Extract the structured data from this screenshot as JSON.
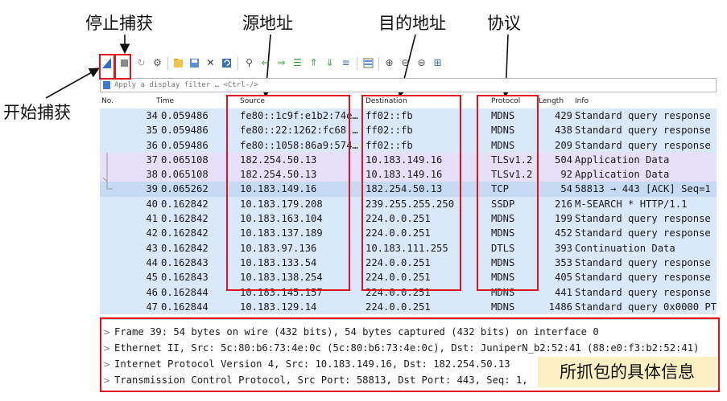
{
  "annotations": {
    "stop_capture": "停止捕获",
    "source_address": "源地址",
    "destination_address": "目的地址",
    "protocol": "协议",
    "start_capture": "开始捕获",
    "packet_details": "所抓包的具体信息"
  },
  "filter": {
    "placeholder": "Apply a display filter … <Ctrl-/>"
  },
  "columns": {
    "no": "No.",
    "time": "Time",
    "source": "Source",
    "destination": "Destination",
    "protocol": "Protocol",
    "length": "Length",
    "info": "Info"
  },
  "packets": [
    {
      "no": "34",
      "time": "0.059486",
      "src": "fe80::1c9f:e1b2:74e…",
      "dst": "ff02::fb",
      "proto": "MDNS",
      "len": "429",
      "info": "Standard query response",
      "color": "#dae8fb"
    },
    {
      "no": "35",
      "time": "0.059486",
      "src": "fe80::22:1262:fc68:…",
      "dst": "ff02::fb",
      "proto": "MDNS",
      "len": "438",
      "info": "Standard query response",
      "color": "#dae8fb"
    },
    {
      "no": "36",
      "time": "0.059486",
      "src": "fe80::1058:86a9:574…",
      "dst": "ff02::fb",
      "proto": "MDNS",
      "len": "209",
      "info": "Standard query response",
      "color": "#dae8fb"
    },
    {
      "no": "37",
      "time": "0.065108",
      "src": "182.254.50.13",
      "dst": "10.183.149.16",
      "proto": "TLSv1.2",
      "len": "504",
      "info": "Application Data",
      "color": "#e6e0fa"
    },
    {
      "no": "38",
      "time": "0.065108",
      "src": "182.254.50.13",
      "dst": "10.183.149.16",
      "proto": "TLSv1.2",
      "len": "92",
      "info": "Application Data",
      "color": "#e6e0fa"
    },
    {
      "no": "39",
      "time": "0.065262",
      "src": "10.183.149.16",
      "dst": "182.254.50.13",
      "proto": "TCP",
      "len": "54",
      "info": "58813 → 443 [ACK] Seq=1",
      "color": "#c6daf4"
    },
    {
      "no": "40",
      "time": "0.162842",
      "src": "10.183.179.208",
      "dst": "239.255.255.250",
      "proto": "SSDP",
      "len": "216",
      "info": "M-SEARCH * HTTP/1.1",
      "color": "#dae8fb"
    },
    {
      "no": "41",
      "time": "0.162842",
      "src": "10.183.163.104",
      "dst": "224.0.0.251",
      "proto": "MDNS",
      "len": "199",
      "info": "Standard query response",
      "color": "#dae8fb"
    },
    {
      "no": "42",
      "time": "0.162842",
      "src": "10.183.137.189",
      "dst": "224.0.0.251",
      "proto": "MDNS",
      "len": "452",
      "info": "Standard query response",
      "color": "#dae8fb"
    },
    {
      "no": "43",
      "time": "0.162842",
      "src": "10.183.97.136",
      "dst": "10.183.111.255",
      "proto": "DTLS",
      "len": "393",
      "info": "Continuation Data",
      "color": "#dae8fb"
    },
    {
      "no": "44",
      "time": "0.162843",
      "src": "10.183.133.54",
      "dst": "224.0.0.251",
      "proto": "MDNS",
      "len": "353",
      "info": "Standard query response",
      "color": "#dae8fb"
    },
    {
      "no": "45",
      "time": "0.162843",
      "src": "10.183.138.254",
      "dst": "224.0.0.251",
      "proto": "MDNS",
      "len": "405",
      "info": "Standard query response",
      "color": "#dae8fb"
    },
    {
      "no": "46",
      "time": "0.162844",
      "src": "10.183.145.157",
      "dst": "224.0.0.251",
      "proto": "MDNS",
      "len": "441",
      "info": "Standard query response",
      "color": "#dae8fb"
    },
    {
      "no": "47",
      "time": "0.162844",
      "src": "10.183.129.14",
      "dst": "224.0.0.251",
      "proto": "MDNS",
      "len": "1486",
      "info": "Standard query 0x0000 PT",
      "color": "#dae8fb"
    }
  ],
  "details": [
    "Frame 39: 54 bytes on wire (432 bits), 54 bytes captured (432 bits) on interface 0",
    "Ethernet II, Src: 5c:80:b6:73:4e:0c (5c:80:b6:73:4e:0c), Dst: JuniperN_b2:52:41 (88:e0:f3:b2:52:41)",
    "Internet Protocol Version 4, Src: 10.183.149.16, Dst: 182.254.50.13",
    "Transmission Control Protocol, Src Port: 58813, Dst Port: 443, Seq: 1,"
  ],
  "colors": {
    "annotation_red": "#e0141c",
    "label_highlight": "#fdf1c4",
    "row_default": "#dae8fb",
    "row_tls": "#e6e0fa",
    "row_selected": "#c6daf4"
  },
  "icons": [
    "start-capture-icon",
    "stop-capture-icon",
    "restart-capture-icon",
    "options-icon",
    "open-file-icon",
    "save-file-icon",
    "close-file-icon",
    "reload-file-icon",
    "find-icon",
    "go-back-icon",
    "go-forward-icon",
    "go-to-packet-icon",
    "go-first-icon",
    "go-last-icon",
    "autoscroll-icon",
    "colorize-icon",
    "zoom-in-icon",
    "zoom-out-icon",
    "normal-size-icon",
    "resize-columns-icon"
  ]
}
